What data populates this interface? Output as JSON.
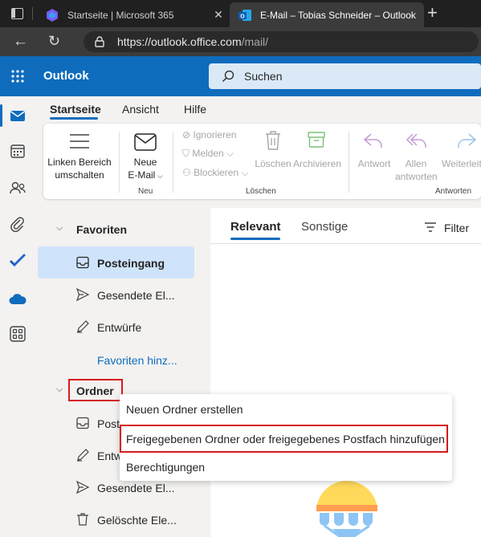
{
  "browser": {
    "tab1_title": "Startseite | Microsoft 365",
    "tab2_title": "E-Mail – Tobias Schneider – Outlook",
    "url_host": "https://outlook.office.com",
    "url_path": "/mail/"
  },
  "app": {
    "name": "Outlook",
    "search_placeholder": "Suchen"
  },
  "ribbon": {
    "tabs": [
      "Startseite",
      "Ansicht",
      "Hilfe"
    ],
    "toggle_pane": [
      "Linken Bereich",
      "umschalten"
    ],
    "new_mail": [
      "Neue",
      "E-Mail"
    ],
    "group_new": "Neu",
    "ignore": "Ignorieren",
    "report": "Melden",
    "block": "Blockieren",
    "delete": "Löschen",
    "archive": "Archivieren",
    "group_delete": "Löschen",
    "reply": "Antwort",
    "reply_all": [
      "Allen",
      "antworten"
    ],
    "forward": "Weiterleiten",
    "group_reply": "Antworten"
  },
  "folders": {
    "favorites_header": "Favoriten",
    "favorites": [
      "Posteingang",
      "Gesendete El...",
      "Entwürfe"
    ],
    "add_favorite": "Favoriten hinz...",
    "folders_header": "Ordner",
    "items": [
      "Poste",
      "Entw",
      "Gesendete El...",
      "Gelöschte Ele..."
    ]
  },
  "maillist": {
    "tab_focused": "Relevant",
    "tab_other": "Sonstige",
    "filter": "Filter"
  },
  "context_menu": {
    "items": [
      "Neuen Ordner erstellen",
      "Freigegebenen Ordner oder freigegebenes Postfach hinzufügen",
      "Berechtigungen"
    ]
  },
  "colors": {
    "brand": "#0f6cbd",
    "selected": "#cfe4fa",
    "highlight": "#d61a1a"
  }
}
